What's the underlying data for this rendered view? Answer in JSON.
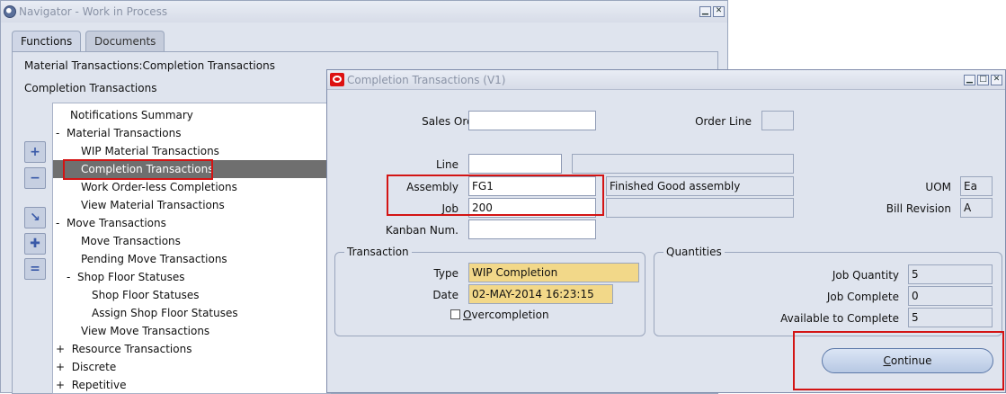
{
  "navigator": {
    "title": "Navigator - Work in Process",
    "tabs": [
      "Functions",
      "Documents"
    ],
    "path_line": "Material Transactions:Completion Transactions",
    "current_function": "Completion Transactions",
    "side_buttons": [
      {
        "icon": "expand-icon",
        "glyph": "+"
      },
      {
        "icon": "collapse-icon",
        "glyph": "−"
      },
      {
        "icon": "expand-branch-icon",
        "glyph": "↘"
      },
      {
        "icon": "expand-all-icon",
        "glyph": "✚"
      },
      {
        "icon": "collapse-all-icon",
        "glyph": "="
      }
    ],
    "tree": [
      {
        "label": "Notifications Summary",
        "prefix": ""
      },
      {
        "label": "Material Transactions",
        "prefix": "-"
      },
      {
        "label": "WIP Material Transactions",
        "prefix": ""
      },
      {
        "label": "Completion Transactions",
        "prefix": ""
      },
      {
        "label": "Work Order-less Completions",
        "prefix": ""
      },
      {
        "label": "View Material Transactions",
        "prefix": ""
      },
      {
        "label": "Move Transactions",
        "prefix": "-"
      },
      {
        "label": "Move Transactions",
        "prefix": ""
      },
      {
        "label": "Pending Move Transactions",
        "prefix": ""
      },
      {
        "label": "Shop Floor Statuses",
        "prefix": "-"
      },
      {
        "label": "Shop Floor Statuses",
        "prefix": ""
      },
      {
        "label": "Assign Shop Floor Statuses",
        "prefix": ""
      },
      {
        "label": "View Move Transactions",
        "prefix": ""
      },
      {
        "label": "Resource Transactions",
        "prefix": "+"
      },
      {
        "label": "Discrete",
        "prefix": "+"
      },
      {
        "label": "Repetitive",
        "prefix": "+"
      }
    ]
  },
  "completion": {
    "title": "Completion Transactions (V1)",
    "labels": {
      "sales_order": "Sales Order",
      "order_line": "Order Line",
      "line": "Line",
      "assembly": "Assembly",
      "job": "Job",
      "kanban": "Kanban Num.",
      "uom": "UOM",
      "bill_revision": "Bill Revision"
    },
    "values": {
      "sales_order": "",
      "order_line": "",
      "line": "",
      "line_desc": "",
      "assembly": "FG1",
      "assembly_desc": "Finished Good assembly",
      "job": "200",
      "job_desc": "",
      "kanban": "",
      "uom": "Ea",
      "bill_revision": "A"
    },
    "transaction": {
      "title": "Transaction",
      "type_label": "Type",
      "type_value": "WIP Completion",
      "date_label": "Date",
      "date_value": "02-MAY-2014 16:23:15",
      "overcompletion_label_u": "O",
      "overcompletion_label_rest": "vercompletion"
    },
    "quantities": {
      "title": "Quantities",
      "job_quantity_label": "Job Quantity",
      "job_quantity": "5",
      "job_complete_label": "Job Complete",
      "job_complete": "0",
      "available_label": "Available to Complete",
      "available": "5"
    },
    "continue_u": "C",
    "continue_rest": "ontinue"
  },
  "highlight_color": "#d31414"
}
